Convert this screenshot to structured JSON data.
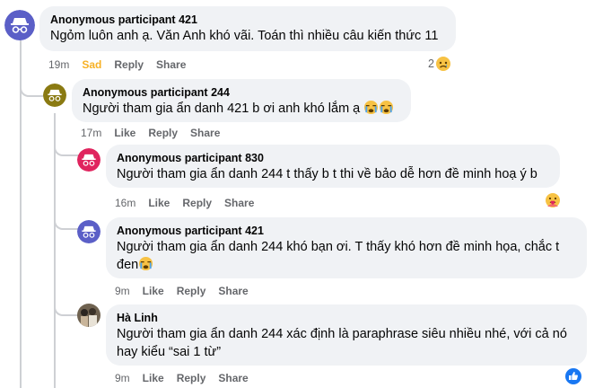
{
  "comments": [
    {
      "author": "Anonymous participant 421",
      "text": "Ngỏm luôn anh ạ. Văn Anh khó vãi. Toán thì nhiều câu kiến thức 11",
      "time": "19m",
      "reaction_label": "Sad",
      "reply": "Reply",
      "share": "Share",
      "reaction_count": "2",
      "reaction_icon": "sad-face-icon",
      "avatar": "anonymous-icon",
      "avatar_color": "#5b5fc7"
    },
    {
      "author": "Anonymous participant 244",
      "text": "Người tham gia ẩn danh 421 b ơi anh khó lắm ạ",
      "time": "17m",
      "like": "Like",
      "reply": "Reply",
      "share": "Share",
      "avatar": "anonymous-icon",
      "avatar_color": "#8a7a12"
    },
    {
      "author": "Anonymous participant 830",
      "text": "Người tham gia ẩn danh 244 t thấy b t thi về bảo dễ hơn đề minh hoạ ý b",
      "time": "16m",
      "like": "Like",
      "reply": "Reply",
      "share": "Share",
      "reaction_icon": "care-face-icon",
      "avatar": "anonymous-icon",
      "avatar_color": "#e0245e"
    },
    {
      "author": "Anonymous participant 421",
      "text_line1": "Người tham gia ẩn danh 244 khó bạn ơi. T thấy khó hơn đề minh họa, chắc t",
      "text_line2": "đen",
      "time": "9m",
      "like": "Like",
      "reply": "Reply",
      "share": "Share",
      "avatar": "anonymous-icon",
      "avatar_color": "#5b5fc7"
    },
    {
      "author": "Hà Linh",
      "text_line1": "Người tham gia ẩn danh 244 xác định là paraphrase siêu nhiều nhé, với cả nó",
      "text_line2": "hay kiểu “sai 1 từ”",
      "time": "9m",
      "like": "Like",
      "reply": "Reply",
      "share": "Share",
      "reaction_icon": "like-icon",
      "avatar": "profile-photo"
    }
  ],
  "colors": {
    "bubble": "#f0f2f5",
    "meta": "#65676b",
    "sad": "#f7b125",
    "like_blue": "#1877f2"
  }
}
